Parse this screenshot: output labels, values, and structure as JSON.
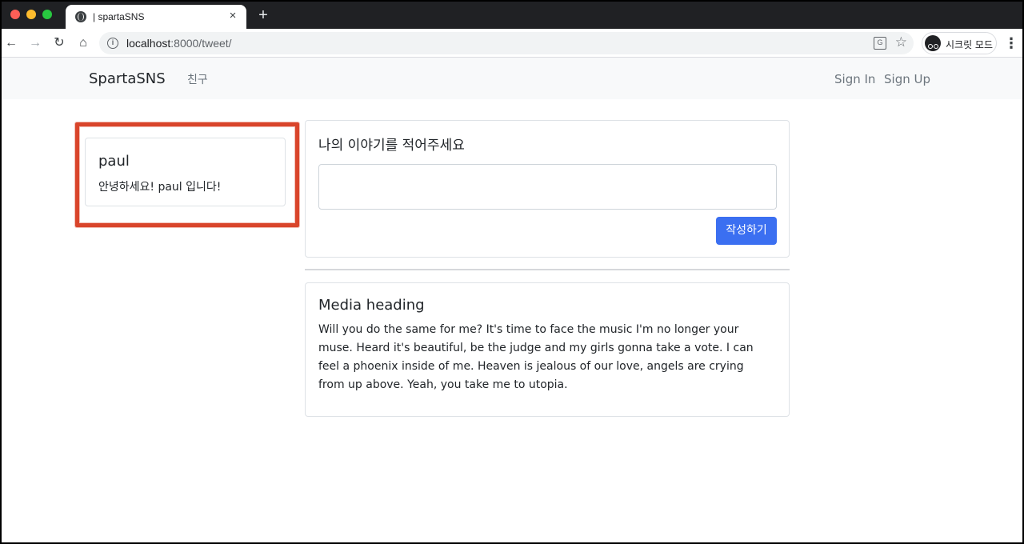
{
  "browser": {
    "tab_title": "| spartaSNS",
    "tab_close_glyph": "×",
    "new_tab_glyph": "+",
    "url_host": "localhost",
    "url_path": ":8000/tweet/",
    "incognito_label": "시크릿 모드",
    "icons": [
      "back-icon",
      "forward-icon",
      "reload-icon",
      "home-icon",
      "info-icon",
      "translate-icon",
      "star-icon",
      "incognito-icon",
      "menu-icon"
    ]
  },
  "navbar": {
    "brand": "SpartaSNS",
    "friends": "친구",
    "sign_in": "Sign In",
    "sign_up": "Sign Up"
  },
  "profile": {
    "name": "paul",
    "bio": "안녕하세요! paul 입니다!"
  },
  "compose": {
    "title": "나의 이야기를 적어주세요",
    "textarea_value": "",
    "submit_label": "작성하기"
  },
  "media": {
    "heading": "Media heading",
    "body": "Will you do the same for me? It's time to face the music I'm no longer your muse. Heard it's beautiful, be the judge and my girls gonna take a vote. I can feel a phoenix inside of me. Heaven is jealous of our love, angels are crying from up above. Yeah, you take me to utopia."
  },
  "colors": {
    "accent": "#3b6ff1",
    "highlight": "#d9452b",
    "navbar_bg": "#f8f9fa"
  }
}
